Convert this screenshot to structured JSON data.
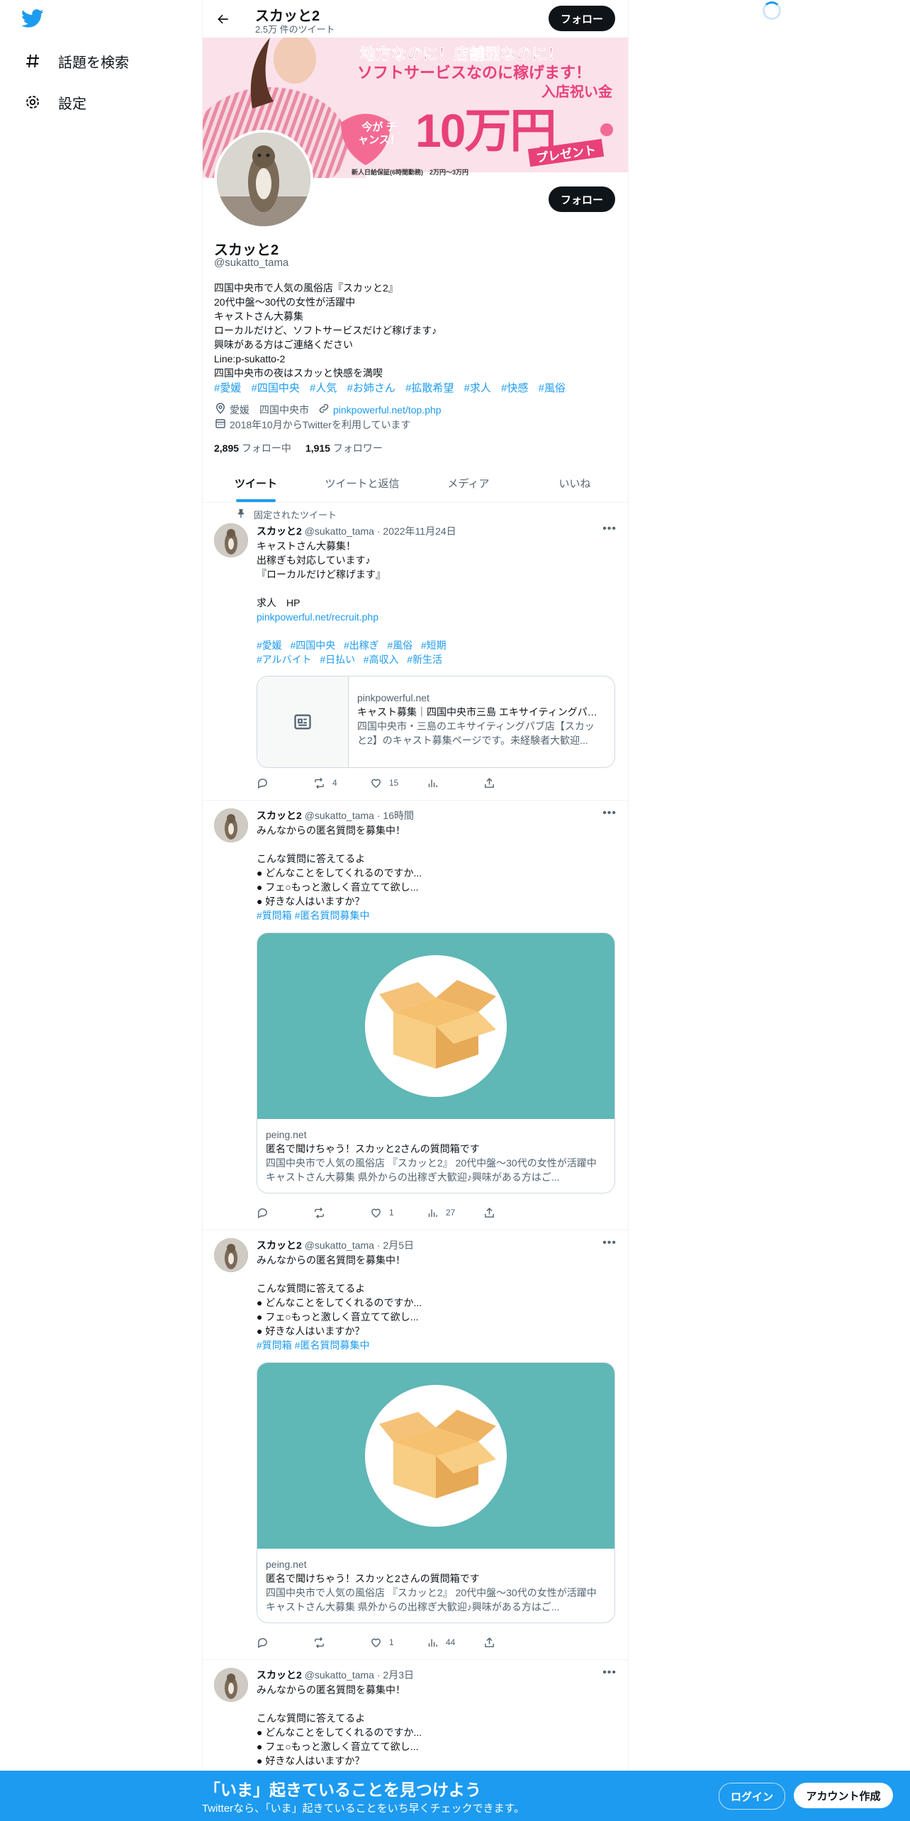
{
  "nav": {
    "explore_label": "話題を検索",
    "settings_label": "設定"
  },
  "topbar": {
    "title": "スカッと2",
    "tweet_count": "2.5万 件のツイート",
    "follow_label": "フォロー"
  },
  "banner": {
    "headline1": "地方なのに！店舗型なのに！",
    "headline2": "ソフトサービスなのに稼げます！",
    "bonus_label": "入店祝い金",
    "bonus_amount": "10万円",
    "present": "プレゼント",
    "chance": "今が チャンス！",
    "guarantee": "新人日給保証(6時間勤務)　2万円〜3万円"
  },
  "profile": {
    "name": "スカッと2",
    "handle": "@sukatto_tama",
    "follow_label": "フォロー",
    "bio": [
      "四国中央市で人気の風俗店『スカッと2』",
      "20代中盤～30代の女性が活躍中",
      "キャストさん大募集",
      "ローカルだけど、ソフトサービスだけど稼げます♪",
      "興味がある方はご連絡ください",
      "Line:p-sukatto-2",
      "四国中央市の夜はスカッと快感を満喫"
    ],
    "hashtags": [
      "#愛媛",
      "#四国中央",
      "#人気",
      "#お姉さん",
      "#拡散希望",
      "#求人",
      "#快感",
      "#風俗"
    ],
    "location": "愛媛　四国中央市",
    "url": "pinkpowerful.net/top.php",
    "joined": "2018年10月からTwitterを利用しています",
    "following_count": "2,895",
    "following_label": "フォロー中",
    "followers_count": "1,915",
    "followers_label": "フォロワー"
  },
  "tabs": [
    "ツイート",
    "ツイートと返信",
    "メディア",
    "いいね"
  ],
  "pinned_label": "固定されたツイート",
  "tweets": [
    {
      "name": "スカッと2",
      "handle": "@sukatto_tama",
      "time": "2022年11月24日",
      "lines": [
        "キャストさん大募集！",
        "出稼ぎも対応しています♪",
        "『ローカルだけど稼げます』",
        "",
        "求人　HP"
      ],
      "link": "pinkpowerful.net/recruit.php",
      "tags1": [
        "#愛媛",
        "#四国中央",
        "#出稼ぎ",
        "#風俗",
        "#短期"
      ],
      "tags2": [
        "#アルバイト",
        "#日払い",
        "#高収入",
        "#新生活"
      ],
      "card": {
        "domain": "pinkpowerful.net",
        "title": "キャスト募集｜四国中央市三島 エキサイティングパブ店【スカッと2】",
        "desc": "四国中央市・三島のエキサイティングパブ店【スカッと2】のキャスト募集ページです。未経験者大歓迎..."
      },
      "replies": "",
      "retweets": "4",
      "likes": "15",
      "views": ""
    },
    {
      "name": "スカッと2",
      "handle": "@sukatto_tama",
      "time": "16時間",
      "lines": [
        "みんなからの匿名質問を募集中！",
        "",
        "こんな質問に答えてるよ",
        "● どんなことをしてくれるのですか...",
        "● フェ○もっと激しく音立てて欲し...",
        "● 好きな人はいますか？"
      ],
      "tags": "#質問箱 #匿名質問募集中",
      "card": {
        "domain": "peing.net",
        "title": "匿名で聞けちゃう！スカッと2さんの質問箱です",
        "desc": "四国中央市で人気の風俗店 『スカッと2』 20代中盤～30代の女性が活躍中 キャストさん大募集 県外からの出稼ぎ大歓迎♪興味がある方はご..."
      },
      "replies": "",
      "retweets": "",
      "likes": "1",
      "views": "27"
    },
    {
      "name": "スカッと2",
      "handle": "@sukatto_tama",
      "time": "2月5日",
      "lines": [
        "みんなからの匿名質問を募集中！",
        "",
        "こんな質問に答えてるよ",
        "● どんなことをしてくれるのですか...",
        "● フェ○もっと激しく音立てて欲し...",
        "● 好きな人はいますか？"
      ],
      "tags": "#質問箱 #匿名質問募集中",
      "card": {
        "domain": "peing.net",
        "title": "匿名で聞けちゃう！スカッと2さんの質問箱です",
        "desc": "四国中央市で人気の風俗店 『スカッと2』 20代中盤～30代の女性が活躍中 キャストさん大募集 県外からの出稼ぎ大歓迎♪興味がある方はご..."
      },
      "replies": "",
      "retweets": "",
      "likes": "1",
      "views": "44"
    },
    {
      "name": "スカッと2",
      "handle": "@sukatto_tama",
      "time": "2月3日",
      "lines": [
        "みんなからの匿名質問を募集中！",
        "",
        "こんな質問に答えてるよ",
        "● どんなことをしてくれるのですか...",
        "● フェ○もっと激しく音立てて欲し...",
        "● 好きな人はいますか？"
      ]
    }
  ],
  "bottom_bar": {
    "title": "「いま」起きていることを見つけよう",
    "subtitle": "Twitterなら、「いま」起きていることをいち早くチェックできます。",
    "login_label": "ログイン",
    "signup_label": "アカウント作成"
  },
  "colors": {
    "accent": "#1d9bf0",
    "text": "#0f1419",
    "muted": "#536471",
    "card_teal": "#5fb7b6"
  }
}
